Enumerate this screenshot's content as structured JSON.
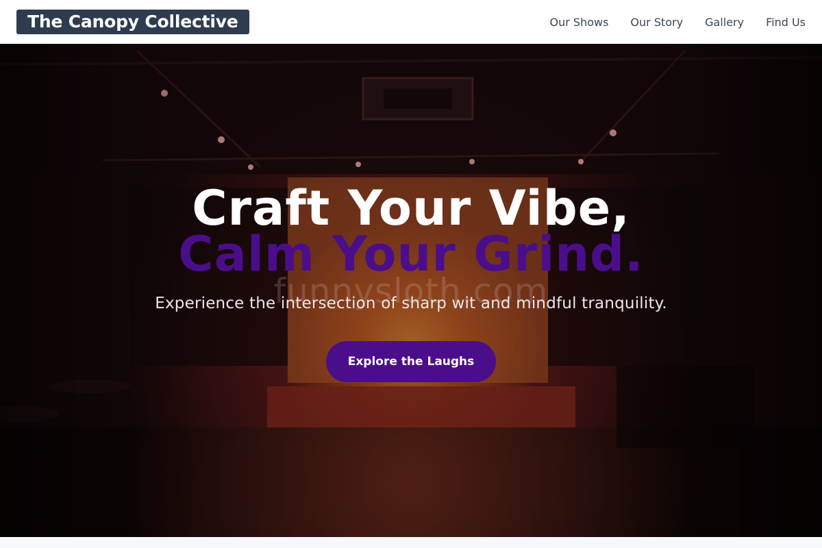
{
  "brand": {
    "name": "The Canopy Collective"
  },
  "nav": {
    "items": [
      {
        "label": "Our Shows"
      },
      {
        "label": "Our Story"
      },
      {
        "label": "Gallery"
      },
      {
        "label": "Find Us"
      }
    ]
  },
  "hero": {
    "title_line1": "Craft Your Vibe,",
    "title_line2": "Calm Your Grind.",
    "watermark": "funnysloth.com",
    "subtitle": "Experience the intersection of sharp wit and mindful tranquility.",
    "cta_label": "Explore the Laughs"
  },
  "colors": {
    "accent": "#4b0e8a",
    "brand_bg": "#2f3c4f",
    "nav_text": "#3a4556"
  }
}
